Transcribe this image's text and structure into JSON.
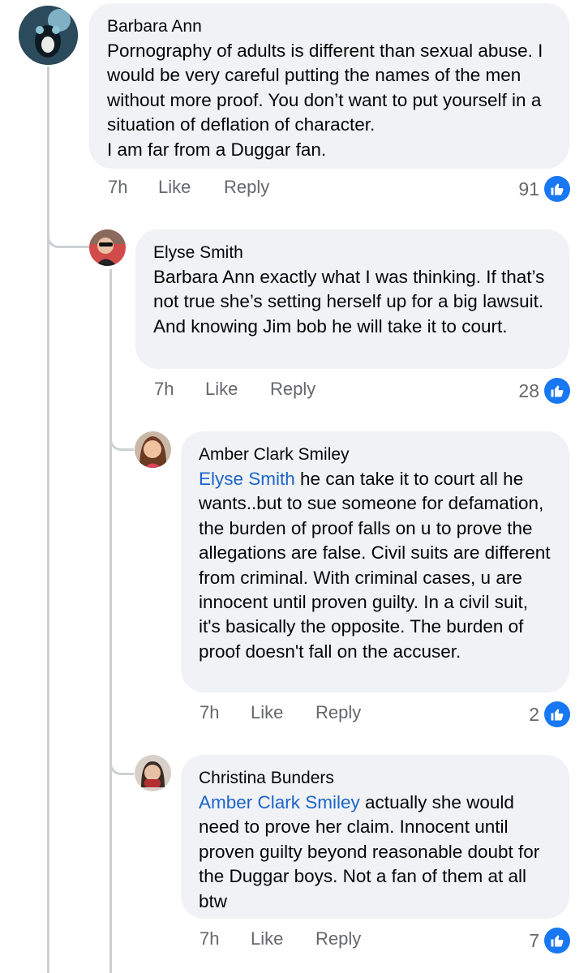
{
  "comments": [
    {
      "author": "Barbara Ann",
      "text": "Pornography of adults is different than sexual abuse. I would be very careful putting the names of the men without more proof. You don’t want to put yourself in a situation of deflation of character.\nI am far from a Duggar fan.",
      "time": "7h",
      "like_label": "Like",
      "reply_label": "Reply",
      "likes": "91"
    },
    {
      "author": "Elyse Smith",
      "text": "Barbara Ann exactly what I was thinking. If that’s not true she’s setting herself up for a big lawsuit. And knowing Jim bob he will take it to court.",
      "time": "7h",
      "like_label": "Like",
      "reply_label": "Reply",
      "likes": "28"
    },
    {
      "author": "Amber Clark Smiley",
      "mention": "Elyse Smith",
      "text": " he can take it to court all he wants..but to sue someone for defamation, the burden of proof falls on u to prove the allegations are false. Civil suits are different from criminal. With criminal cases, u are innocent until proven guilty. In a civil suit, it's basically the opposite. The burden of proof doesn't fall on the accuser.",
      "time": "7h",
      "like_label": "Like",
      "reply_label": "Reply",
      "likes": "2"
    },
    {
      "author": "Christina Bunders",
      "mention": "Amber Clark Smiley",
      "text": " actually she would need to prove her claim. Innocent until proven guilty beyond reasonable doubt for the Duggar boys. Not a fan of them at all btw",
      "time": "7h",
      "like_label": "Like",
      "reply_label": "Reply",
      "likes": "7"
    }
  ],
  "colors": {
    "bubble": "#f0f2f5",
    "mention": "#1b64c9",
    "like_badge": "#1877f2",
    "meta": "#65676b"
  },
  "icons": {
    "like_reaction": "thumbs-up-icon"
  }
}
